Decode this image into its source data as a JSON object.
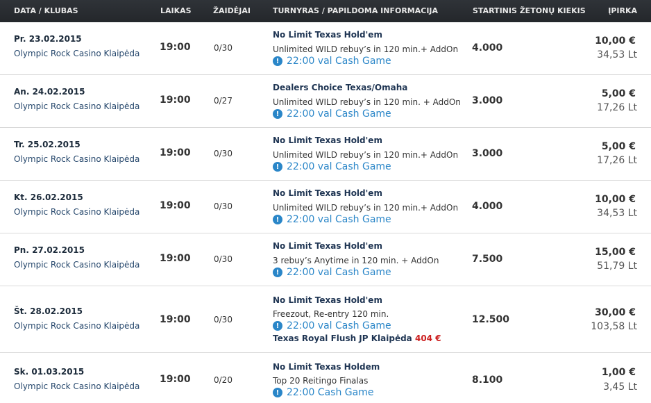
{
  "header": {
    "date_club": "DATA / KLUBAS",
    "time": "LAIKAS",
    "players": "ŽAIDĖJAI",
    "tournament": "TURNYRAS / PAPILDOMA INFORMACIJA",
    "chips": "STARTINIS ŽETONŲ KIEKIS",
    "buyin": "ĮPIRKA"
  },
  "rows": [
    {
      "date": "Pr. 23.02.2015",
      "club": "Olympic Rock Casino Klaipėda",
      "time": "19:00",
      "players": "0/30",
      "name": "No Limit Texas Hold'em",
      "info": "Unlimited WILD  rebuy’s in 120 min.+ AddOn",
      "cash": "22:00 val Cash Game",
      "chips": "4.000",
      "eur": "10,00 €",
      "lt": "34,53 Lt"
    },
    {
      "date": "An. 24.02.2015",
      "club": "Olympic Rock Casino Klaipėda",
      "time": "19:00",
      "players": "0/27",
      "name": "Dealers Choice Texas/Omaha",
      "info": "Unlimited WILD rebuy’s in 120 min. + AddOn",
      "cash": "22:00 val Cash Game",
      "chips": "3.000",
      "eur": "5,00 €",
      "lt": "17,26 Lt"
    },
    {
      "date": "Tr. 25.02.2015",
      "club": "Olympic Rock Casino Klaipėda",
      "time": "19:00",
      "players": "0/30",
      "name": "No Limit Texas Hold'em",
      "info": "Unlimited WILD   rebuy’s in 120 min.+ AddOn",
      "cash": "22:00 val Cash Game",
      "chips": "3.000",
      "eur": "5,00 €",
      "lt": "17,26 Lt"
    },
    {
      "date": "Kt. 26.02.2015",
      "club": "Olympic Rock Casino Klaipėda",
      "time": "19:00",
      "players": "0/30",
      "name": "No Limit Texas Hold'em",
      "info": "Unlimited WILD   rebuy’s in 120 min.+ AddOn",
      "cash": "22:00 val Cash Game",
      "chips": "4.000",
      "eur": "10,00 €",
      "lt": "34,53 Lt"
    },
    {
      "date": "Pn. 27.02.2015",
      "club": "Olympic Rock Casino Klaipėda",
      "time": "19:00",
      "players": "0/30",
      "name": "No Limit Texas Hold'em",
      "info": "3 rebuy’s Anytime in 120 min. + AddOn",
      "cash": "22:00 val Cash Game",
      "chips": "7.500",
      "eur": "15,00 €",
      "lt": "51,79 Lt"
    },
    {
      "date": "Št. 28.02.2015",
      "club": "Olympic Rock Casino Klaipėda",
      "time": "19:00",
      "players": "0/30",
      "name": "No Limit Texas Hold'em",
      "info": "Freezout, Re-entry 120 min.",
      "cash": "22:00 val Cash Game",
      "extra": "Texas Royal Flush JP Klaipėda",
      "extra_amount": "404 €",
      "chips": "12.500",
      "eur": "30,00 €",
      "lt": "103,58 Lt"
    },
    {
      "date": "Sk. 01.03.2015",
      "club": "Olympic Rock Casino Klaipėda",
      "time": "19:00",
      "players": "0/20",
      "name": "No Limit Texas Holdem",
      "info": "Top 20 Reitingo Finalas",
      "cash": "22:00 Cash Game",
      "chips": "8.100",
      "eur": "1,00 €",
      "lt": "3,45 Lt"
    }
  ],
  "icons": {
    "info": "info-icon",
    "info_glyph": "!"
  },
  "colors": {
    "header_bg": "#2a2e33",
    "link_blue": "#2a86c8",
    "jackpot_red": "#cc1f1f"
  }
}
